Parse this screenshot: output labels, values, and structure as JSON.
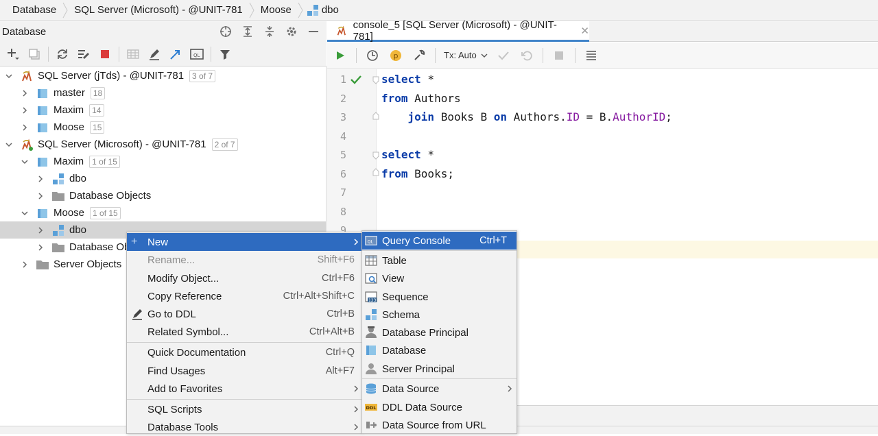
{
  "breadcrumb": [
    "Database",
    "SQL Server (Microsoft) - @UNIT-781",
    "Moose",
    "dbo"
  ],
  "left_panel": {
    "title": "Database",
    "header_icons": [
      "crosshair-icon",
      "expand-all-icon",
      "collapse-all-icon",
      "gear-icon",
      "minimize-icon"
    ],
    "toolbar_icons": [
      "add-icon",
      "duplicate-icon",
      "refresh-icon",
      "properties-icon",
      "stop-icon",
      "table-view-icon",
      "edit-icon",
      "jump-to-source-icon",
      "query-console-icon",
      "filter-icon"
    ]
  },
  "tree": [
    {
      "label": "SQL Server (jTds) - @UNIT-781",
      "badge": "3 of 7",
      "expanded": true,
      "icon": "datasource-icon"
    },
    {
      "label": "master",
      "badge": "18",
      "expanded": false,
      "icon": "database-icon"
    },
    {
      "label": "Maxim",
      "badge": "14",
      "expanded": false,
      "icon": "database-icon"
    },
    {
      "label": "Moose",
      "badge": "15",
      "expanded": false,
      "icon": "database-icon"
    },
    {
      "label": "SQL Server (Microsoft) - @UNIT-781",
      "badge": "2 of 7",
      "expanded": true,
      "icon": "datasource-icon"
    },
    {
      "label": "Maxim",
      "badge": "1 of 15",
      "expanded": true,
      "icon": "database-icon"
    },
    {
      "label": "dbo",
      "badge": "",
      "expanded": false,
      "icon": "schema-icon"
    },
    {
      "label": "Database Objects",
      "badge": "",
      "expanded": false,
      "icon": "folder-icon"
    },
    {
      "label": "Moose",
      "badge": "1 of 15",
      "expanded": true,
      "icon": "database-icon"
    },
    {
      "label": "dbo",
      "badge": "",
      "expanded": false,
      "icon": "schema-icon",
      "selected": true
    },
    {
      "label": "Database Ob",
      "badge": "",
      "expanded": false,
      "icon": "folder-icon"
    },
    {
      "label": "Server Objects",
      "badge": "",
      "expanded": false,
      "icon": "folder-icon"
    }
  ],
  "editor": {
    "tab_title": "console_5 [SQL Server (Microsoft) - @UNIT-781]",
    "tx_mode": "Tx: Auto",
    "line_numbers": [
      "1",
      "2",
      "3",
      "4",
      "5",
      "6",
      "7",
      "8",
      "9"
    ]
  },
  "context_menu": [
    {
      "label": "New",
      "shortcut": "",
      "submenu": true,
      "active": true
    },
    {
      "label": "Rename...",
      "shortcut": "Shift+F6",
      "disabled": true
    },
    {
      "label": "Modify Object...",
      "shortcut": "Ctrl+F6"
    },
    {
      "label": "Copy Reference",
      "shortcut": "Ctrl+Alt+Shift+C"
    },
    {
      "label": "Go to DDL",
      "shortcut": "Ctrl+B"
    },
    {
      "label": "Related Symbol...",
      "shortcut": "Ctrl+Alt+B"
    },
    {
      "label": "Quick Documentation",
      "shortcut": "Ctrl+Q"
    },
    {
      "label": "Find Usages",
      "shortcut": "Alt+F7"
    },
    {
      "label": "Add to Favorites",
      "shortcut": "",
      "submenu": true
    },
    {
      "label": "SQL Scripts",
      "shortcut": "",
      "submenu": true
    },
    {
      "label": "Database Tools",
      "shortcut": "",
      "submenu": true
    }
  ],
  "submenu": [
    {
      "label": "Query Console",
      "shortcut": "Ctrl+T",
      "active": true,
      "icon": "query-console-icon"
    },
    {
      "label": "Table",
      "icon": "table-icon"
    },
    {
      "label": "View",
      "icon": "view-icon"
    },
    {
      "label": "Sequence",
      "icon": "sequence-icon"
    },
    {
      "label": "Schema",
      "icon": "schema-icon"
    },
    {
      "label": "Database Principal",
      "icon": "user-icon"
    },
    {
      "label": "Database",
      "icon": "database-icon"
    },
    {
      "label": "Server Principal",
      "icon": "user-icon"
    },
    {
      "label": "Data Source",
      "submenu": true,
      "icon": "datasource-stack-icon"
    },
    {
      "label": "DDL Data Source",
      "icon": "ddl-icon"
    },
    {
      "label": "Data Source from URL",
      "icon": "url-datasource-icon"
    }
  ],
  "colors": {
    "accent": "#2e6bc0",
    "keyword": "#0b3ca8",
    "field": "#861aa0",
    "run": "#3a9c3a",
    "stop": "#db3b3b"
  }
}
